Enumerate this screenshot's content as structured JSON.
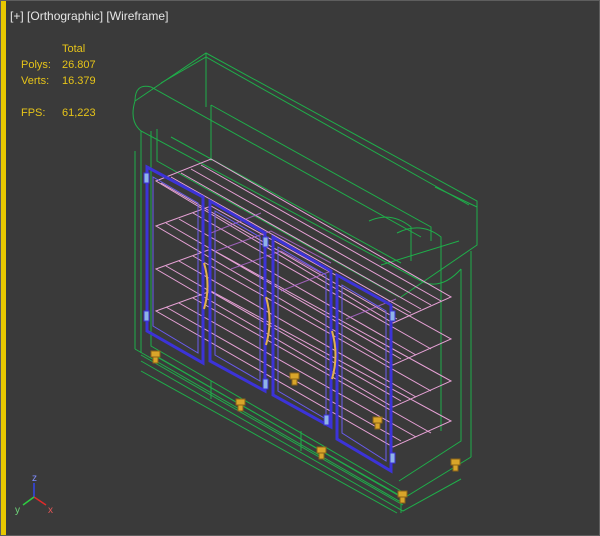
{
  "viewport": {
    "menu_plus": "[+]",
    "view_name": "[Orthographic]",
    "shading_mode": "[Wireframe]"
  },
  "stats": {
    "header": "Total",
    "polys_label": "Polys:",
    "polys_value": "26.807",
    "verts_label": "Verts:",
    "verts_value": "16.379",
    "fps_label": "FPS:",
    "fps_value": "61,223"
  },
  "axis": {
    "x_label": "x",
    "y_label": "y",
    "z_label": "z"
  },
  "colors": {
    "background": "#3a3a3a",
    "frame_green": "#1fae4a",
    "door_frame_blue": "#3c33d8",
    "shelf_pink": "#e7a2d6",
    "interior_violet": "#b86bd9",
    "feet_gold": "#d9a52a",
    "stats_yellow": "#e6c419"
  }
}
